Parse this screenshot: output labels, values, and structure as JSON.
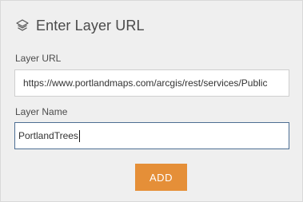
{
  "dialog": {
    "title": "Enter Layer URL",
    "icon": "layers-icon"
  },
  "layer_url": {
    "label": "Layer URL",
    "value": "https://www.portlandmaps.com/arcgis/rest/services/Public"
  },
  "layer_name": {
    "label": "Layer Name",
    "value": "PortlandTrees"
  },
  "add_button": {
    "label": "ADD",
    "color": "#e58f38"
  }
}
